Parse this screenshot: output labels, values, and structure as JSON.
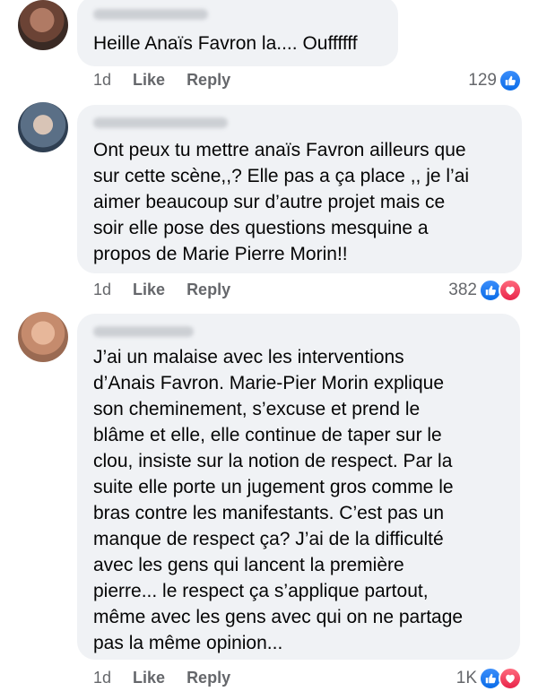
{
  "comments": [
    {
      "text": "Heille Anaïs Favron la.... Ouffffff",
      "time": "1d",
      "like_label": "Like",
      "reply_label": "Reply",
      "reaction_count": "129",
      "reactions": [
        "like-icon"
      ]
    },
    {
      "text": "Ont peux tu mettre anaïs Favron ailleurs que\nsur cette scène,,? Elle pas a ça place ,, je l’ai\naimer beaucoup sur d’autre projet mais ce\nsoir elle pose des questions mesquine a\npropos de Marie Pierre Morin!!",
      "time": "1d",
      "like_label": "Like",
      "reply_label": "Reply",
      "reaction_count": "382",
      "reactions": [
        "like-icon",
        "love-icon"
      ]
    },
    {
      "text": "J’ai un malaise avec les interventions\nd’Anais Favron. Marie-Pier Morin explique\nson cheminement, s’excuse et prend le\nblâme et elle, elle continue de taper sur le\nclou, insiste sur la notion de respect. Par la\nsuite elle porte un jugement gros comme le\nbras contre les manifestants. C’est pas un\nmanque de respect ça? J’ai de la difficulté\navec les gens qui lancent la première\npierre... le respect ça s’applique partout,\nmême avec les gens avec qui on ne partage\npas la même opinion...",
      "time": "1d",
      "like_label": "Like",
      "reply_label": "Reply",
      "reaction_count": "1K",
      "reactions": [
        "like-icon",
        "love-icon"
      ]
    }
  ]
}
